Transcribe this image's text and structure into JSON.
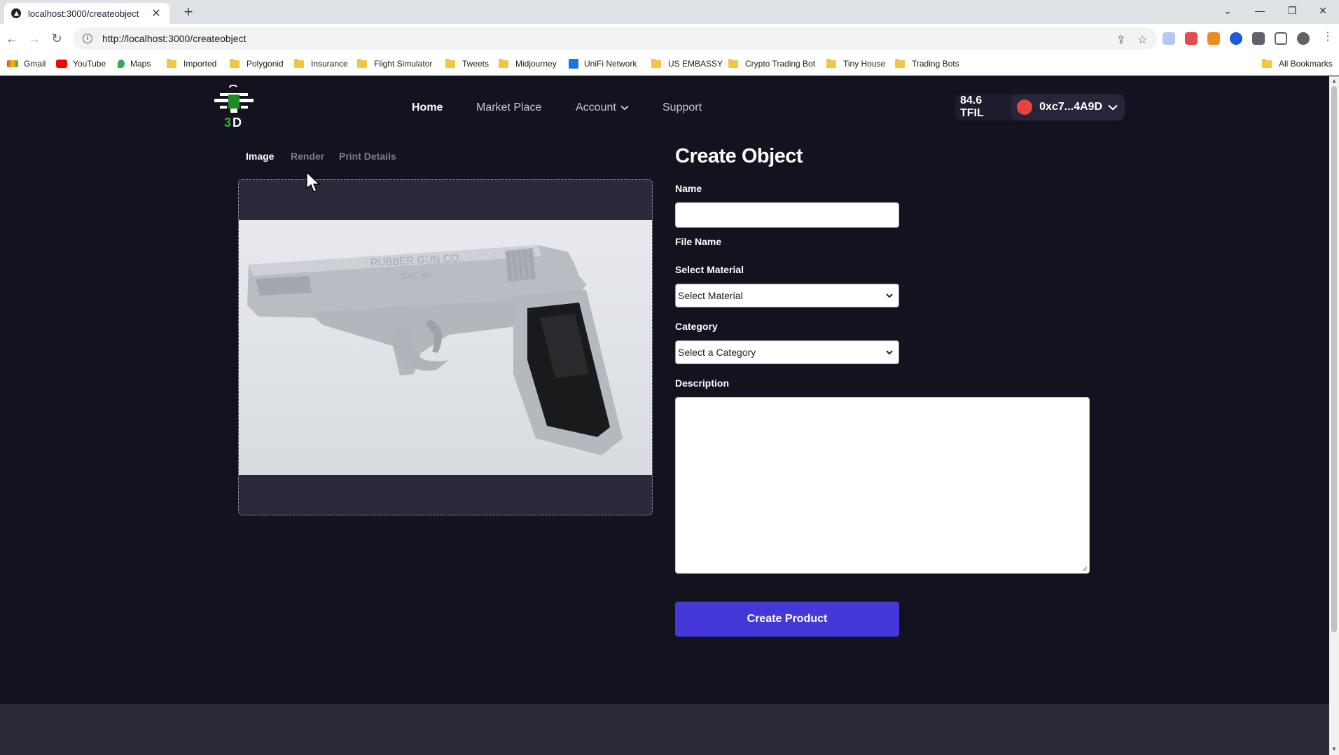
{
  "browser": {
    "tab_title": "localhost:3000/createobject",
    "url": "http://localhost:3000/createobject",
    "bookmarks": [
      "Gmail",
      "YouTube",
      "Maps",
      "Imported",
      "Polygonid",
      "Insurance",
      "Flight Simulator",
      "Tweets",
      "Midjourney",
      "UniFi Network",
      "US EMBASSY",
      "Crypto Trading Bot",
      "Tiny House",
      "Trading Bots"
    ],
    "all_bookmarks": "All Bookmarks"
  },
  "nav": {
    "home": "Home",
    "marketplace": "Market Place",
    "account": "Account",
    "support": "Support"
  },
  "wallet": {
    "balance": "84.6 TFIL",
    "address": "0xc7...4A9D"
  },
  "tabs": [
    "Image",
    "Render",
    "Print Details"
  ],
  "form": {
    "title": "Create Object",
    "name_label": "Name",
    "name_value": "",
    "file_name_label": "File Name",
    "material_label": "Select Material",
    "material_value": "Select Material",
    "category_label": "Category",
    "category_value": "Select a Category",
    "description_label": "Description",
    "description_value": "",
    "submit": "Create Product"
  },
  "colors": {
    "background": "#13121f",
    "accent": "#4438d8",
    "wallet_avatar": "#e8423f",
    "footer": "#2a2938"
  },
  "icons": [
    "logo-3d-printer-icon",
    "chevron-down-icon",
    "wallet-avatar-icon",
    "mouse-cursor-icon"
  ]
}
